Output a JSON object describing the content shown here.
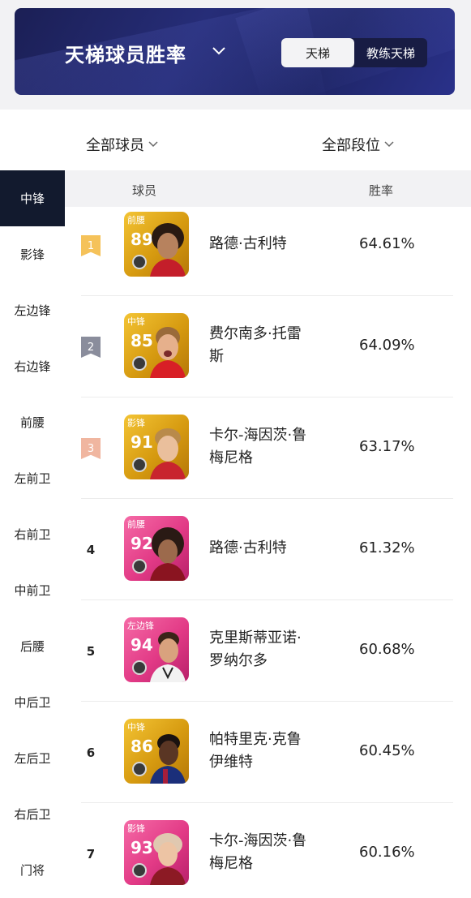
{
  "header": {
    "title": "天梯球员胜率",
    "segments": [
      "天梯",
      "教练天梯"
    ]
  },
  "filters": {
    "players": "全部球员",
    "tiers": "全部段位"
  },
  "nav": [
    "中锋",
    "影锋",
    "左边锋",
    "右边锋",
    "前腰",
    "左前卫",
    "右前卫",
    "中前卫",
    "后腰",
    "中后卫",
    "左后卫",
    "右后卫",
    "门将"
  ],
  "table": {
    "col_player": "球员",
    "col_rate": "胜率",
    "rows": [
      {
        "rank": "1",
        "pos": "前腰",
        "ovr": "89",
        "card": "gold",
        "name1": "路德·古利特",
        "name2": "",
        "rate": "64.61%"
      },
      {
        "rank": "2",
        "pos": "中锋",
        "ovr": "85",
        "card": "gold",
        "name1": "费尔南多·托雷",
        "name2": "斯",
        "rate": "64.09%"
      },
      {
        "rank": "3",
        "pos": "影锋",
        "ovr": "91",
        "card": "gold",
        "name1": "卡尔-海因茨·鲁",
        "name2": "梅尼格",
        "rate": "63.17%"
      },
      {
        "rank": "4",
        "pos": "前腰",
        "ovr": "92",
        "card": "pink",
        "name1": "路德·古利特",
        "name2": "",
        "rate": "61.32%"
      },
      {
        "rank": "5",
        "pos": "左边锋",
        "ovr": "94",
        "card": "pink",
        "name1": "克里斯蒂亚诺·",
        "name2": "罗纳尔多",
        "rate": "60.68%"
      },
      {
        "rank": "6",
        "pos": "中锋",
        "ovr": "86",
        "card": "gold",
        "name1": "帕特里克·克鲁",
        "name2": "伊维特",
        "rate": "60.45%"
      },
      {
        "rank": "7",
        "pos": "影锋",
        "ovr": "93",
        "card": "pink",
        "name1": "卡尔-海因茨·鲁",
        "name2": "梅尼格",
        "rate": "60.16%"
      }
    ]
  },
  "colors": {
    "rank1": "#f5c25a",
    "rank2": "#8a8d9c",
    "rank3": "#f0b6a0"
  }
}
